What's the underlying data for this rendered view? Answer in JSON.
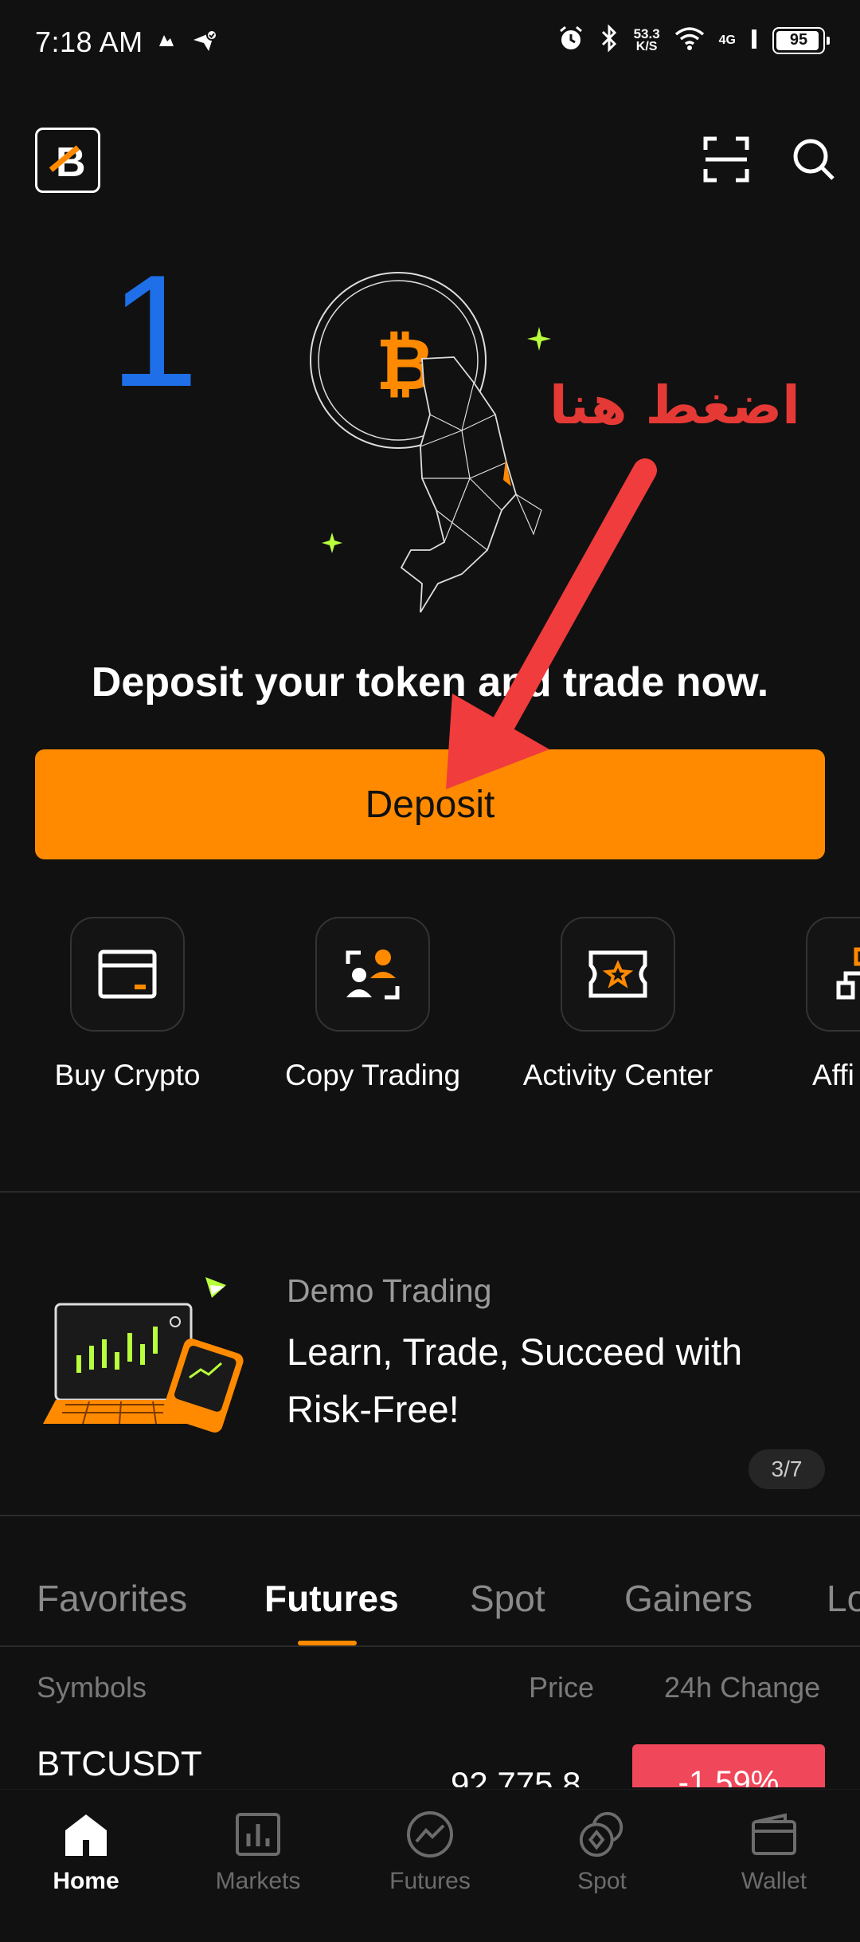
{
  "status_bar": {
    "time": "7:18 AM",
    "net_speed_value": "53.3",
    "net_speed_unit": "K/S",
    "network": "4G",
    "battery": "95",
    "battery_level": 0.95
  },
  "header": {
    "logo_letter": "B",
    "scan_icon": "scan-icon",
    "search_icon": "search-icon"
  },
  "annotations": {
    "step_number": "1",
    "arabic_text": "اضغط هنا"
  },
  "hero": {
    "title": "Deposit your token and trade now.",
    "deposit_button": "Deposit"
  },
  "quick_actions": [
    {
      "label": "Buy Crypto",
      "icon": "card-icon"
    },
    {
      "label": "Copy Trading",
      "icon": "copy-trading-icon"
    },
    {
      "label": "Activity Center",
      "icon": "ticket-star-icon"
    },
    {
      "label": "Affi",
      "icon": "affiliate-icon"
    }
  ],
  "banner": {
    "subtitle": "Demo Trading",
    "title": "Learn, Trade, Succeed with Risk-Free!",
    "page_indicator": "3/7"
  },
  "tabs": [
    "Favorites",
    "Futures",
    "Spot",
    "Gainers",
    "Lo"
  ],
  "active_tab": "Futures",
  "table": {
    "headers": {
      "symbol": "Symbols",
      "price": "Price",
      "change": "24h Change"
    },
    "rows": [
      {
        "symbol": "BTCUSDT",
        "price": "92,775.8",
        "change": "-1.59%"
      }
    ]
  },
  "bottom_nav": [
    {
      "label": "Home",
      "icon": "home-icon",
      "active": true
    },
    {
      "label": "Markets",
      "icon": "bar-chart-icon",
      "active": false
    },
    {
      "label": "Futures",
      "icon": "futures-icon",
      "active": false
    },
    {
      "label": "Spot",
      "icon": "spot-icon",
      "active": false
    },
    {
      "label": "Wallet",
      "icon": "wallet-icon",
      "active": false
    }
  ],
  "colors": {
    "background": "#111111",
    "accent": "#ff8a00",
    "negative": "#f0475a",
    "annotation_blue": "#1e6fe8",
    "annotation_red": "#e53935",
    "sparkle_green": "#b8ff3c"
  }
}
